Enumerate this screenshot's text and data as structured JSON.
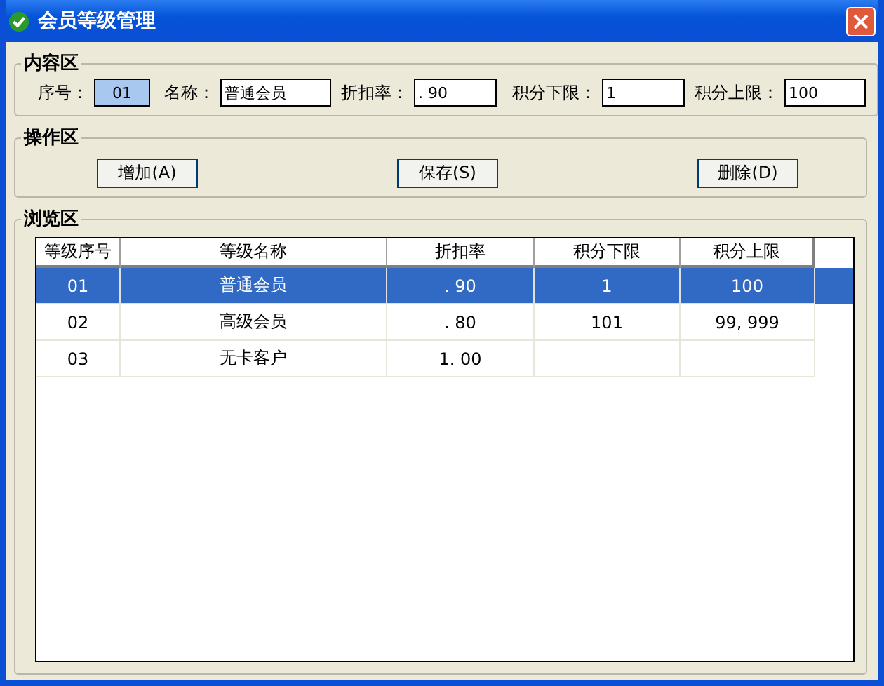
{
  "window": {
    "title": "会员等级管理"
  },
  "content_group": {
    "title": "内容区",
    "fields": [
      {
        "label": "序号：",
        "value": "01",
        "focused": true
      },
      {
        "label": "名称：",
        "value": "普通会员",
        "focused": false
      },
      {
        "label": "折扣率：",
        "value": ". 90",
        "focused": false
      },
      {
        "label": "积分下限：",
        "value": "1",
        "focused": false
      },
      {
        "label": "积分上限：",
        "value": "100",
        "focused": false
      }
    ]
  },
  "action_group": {
    "title": "操作区",
    "buttons": [
      "增加(A)",
      "保存(S)",
      "删除(D)"
    ]
  },
  "browse_group": {
    "title": "浏览区",
    "table": {
      "columns": [
        "等级序号",
        "等级名称",
        "折扣率",
        "积分下限",
        "积分上限"
      ],
      "rows": [
        {
          "cells": [
            "01",
            "普通会员",
            ". 90",
            "1",
            "100"
          ],
          "selected": true
        },
        {
          "cells": [
            "02",
            "高级会员",
            ". 80",
            "101",
            "99, 999"
          ],
          "selected": false
        },
        {
          "cells": [
            "03",
            "无卡客户",
            "1. 00",
            "",
            ""
          ],
          "selected": false
        }
      ]
    }
  }
}
